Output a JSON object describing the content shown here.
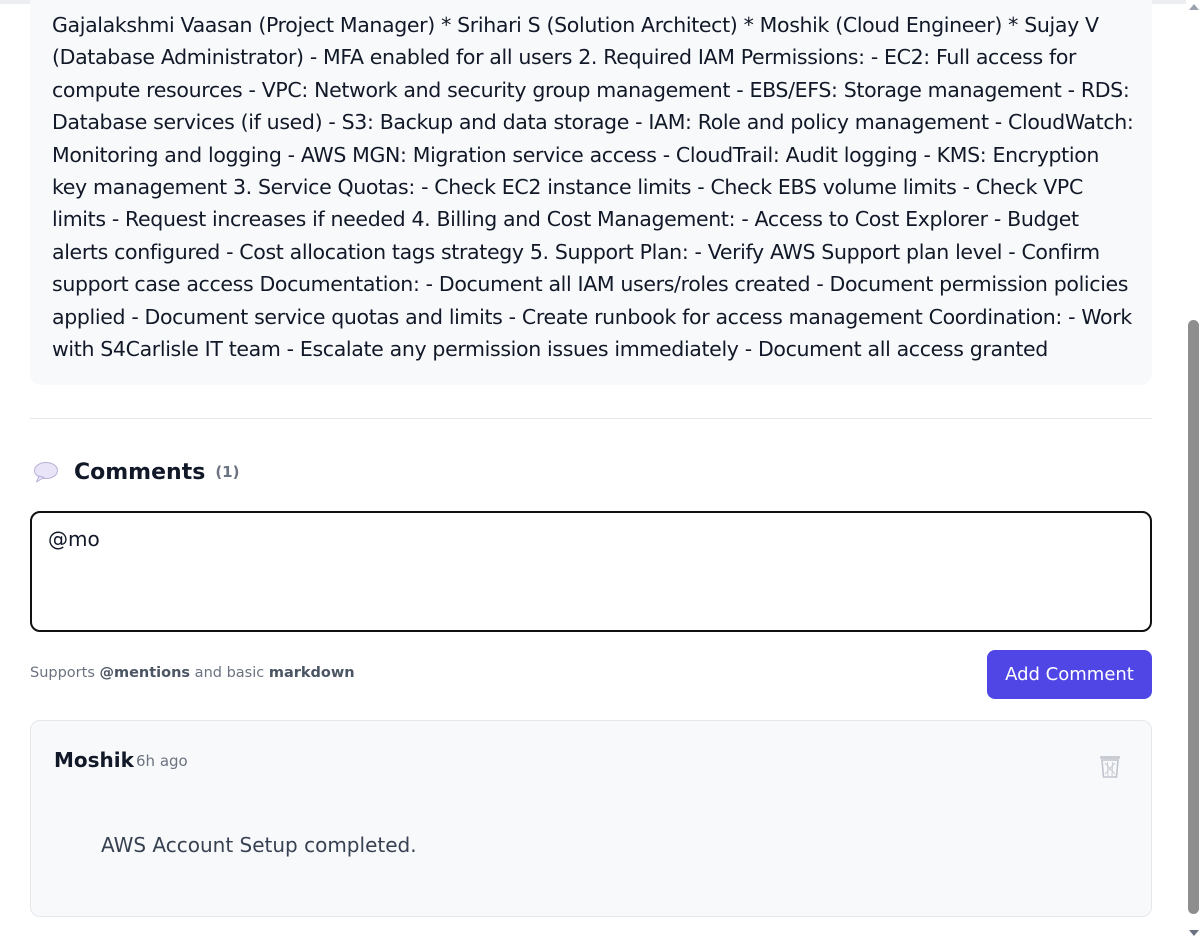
{
  "description": {
    "text": "Gajalakshmi Vaasan (Project Manager) * Srihari S (Solution Architect) * Moshik (Cloud Engineer) * Sujay V (Database Administrator) - MFA enabled for all users 2. Required IAM Permissions: - EC2: Full access for compute resources - VPC: Network and security group management - EBS/EFS: Storage management - RDS: Database services (if used) - S3: Backup and data storage - IAM: Role and policy management - CloudWatch: Monitoring and logging - AWS MGN: Migration service access - CloudTrail: Audit logging - KMS: Encryption key management 3. Service Quotas: - Check EC2 instance limits - Check EBS volume limits - Check VPC limits - Request increases if needed 4. Billing and Cost Management: - Access to Cost Explorer - Budget alerts configured - Cost allocation tags strategy 5. Support Plan: - Verify AWS Support plan level - Confirm support case access Documentation: - Document all IAM users/roles created - Document permission policies applied - Document service quotas and limits - Create runbook for access management Coordination: - Work with S4Carlisle IT team - Escalate any permission issues immediately - Document all access granted"
  },
  "comments": {
    "icon": "speech-bubble-icon",
    "title": "Comments",
    "count": "(1)",
    "input_value": "@mo",
    "hint_prefix": "Supports ",
    "hint_mentions": "@mentions",
    "hint_middle": " and basic ",
    "hint_markdown": "markdown",
    "add_button": "Add Comment",
    "items": [
      {
        "author": "Moshik",
        "time": "6h ago",
        "body": "AWS Account Setup completed.",
        "delete_icon": "trash-icon"
      }
    ]
  },
  "colors": {
    "accent": "#4f46e5",
    "card_bg": "#f8f9fb",
    "muted_text": "#6b7280"
  }
}
